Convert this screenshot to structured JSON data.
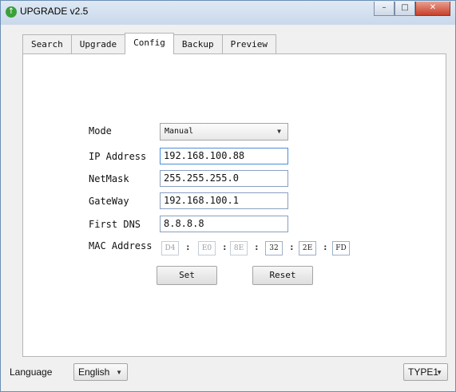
{
  "window": {
    "title": "UPGRADE v2.5"
  },
  "tabs": [
    "Search",
    "Upgrade",
    "Config",
    "Backup",
    "Preview"
  ],
  "active_tab": "Config",
  "config": {
    "mode_label": "Mode",
    "mode_value": "Manual",
    "ip_label": "IP Address",
    "ip_value": "192.168.100.88",
    "netmask_label": "NetMask",
    "netmask_value": "255.255.255.0",
    "gateway_label": "GateWay",
    "gateway_value": "192.168.100.1",
    "dns_label": "First DNS",
    "dns_value": "8.8.8.8",
    "mac_label": "MAC Address",
    "mac_octets": [
      "D4",
      "E0",
      "8E",
      "32",
      "2E",
      "FD"
    ],
    "mac_separator": ":",
    "set_label": "Set",
    "reset_label": "Reset"
  },
  "footer": {
    "language_label": "Language",
    "language_value": "English",
    "type_value": "TYPE1"
  },
  "icons": {
    "app": "app-upgrade-icon",
    "dropdown": "chevron-down-icon",
    "minimize": "minimize-icon",
    "maximize": "maximize-icon",
    "close": "close-icon"
  }
}
